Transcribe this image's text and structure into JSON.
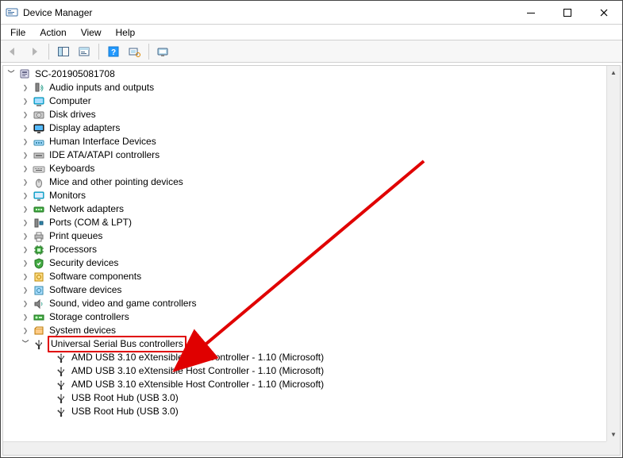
{
  "window": {
    "title": "Device Manager"
  },
  "menu": {
    "file": "File",
    "action": "Action",
    "view": "View",
    "help": "Help"
  },
  "root": {
    "name": "SC-201905081708",
    "expanded": true
  },
  "categories": [
    {
      "name": "Audio inputs and outputs",
      "icon": "audio",
      "expanded": false
    },
    {
      "name": "Computer",
      "icon": "computer",
      "expanded": false
    },
    {
      "name": "Disk drives",
      "icon": "disk",
      "expanded": false
    },
    {
      "name": "Display adapters",
      "icon": "display",
      "expanded": false
    },
    {
      "name": "Human Interface Devices",
      "icon": "hid",
      "expanded": false
    },
    {
      "name": "IDE ATA/ATAPI controllers",
      "icon": "ide",
      "expanded": false
    },
    {
      "name": "Keyboards",
      "icon": "keyboard",
      "expanded": false
    },
    {
      "name": "Mice and other pointing devices",
      "icon": "mouse",
      "expanded": false
    },
    {
      "name": "Monitors",
      "icon": "monitor",
      "expanded": false
    },
    {
      "name": "Network adapters",
      "icon": "network",
      "expanded": false
    },
    {
      "name": "Ports (COM & LPT)",
      "icon": "ports",
      "expanded": false
    },
    {
      "name": "Print queues",
      "icon": "print",
      "expanded": false
    },
    {
      "name": "Processors",
      "icon": "cpu",
      "expanded": false
    },
    {
      "name": "Security devices",
      "icon": "security",
      "expanded": false
    },
    {
      "name": "Software components",
      "icon": "softcomp",
      "expanded": false
    },
    {
      "name": "Software devices",
      "icon": "softdev",
      "expanded": false
    },
    {
      "name": "Sound, video and game controllers",
      "icon": "sound",
      "expanded": false
    },
    {
      "name": "Storage controllers",
      "icon": "storage",
      "expanded": false
    },
    {
      "name": "System devices",
      "icon": "system",
      "expanded": false
    },
    {
      "name": "Universal Serial Bus controllers",
      "icon": "usb",
      "expanded": true,
      "highlighted": true,
      "children": [
        {
          "name": "AMD USB 3.10 eXtensible Host Controller - 1.10 (Microsoft)",
          "icon": "usb"
        },
        {
          "name": "AMD USB 3.10 eXtensible Host Controller - 1.10 (Microsoft)",
          "icon": "usb"
        },
        {
          "name": "AMD USB 3.10 eXtensible Host Controller - 1.10 (Microsoft)",
          "icon": "usb"
        },
        {
          "name": "USB Root Hub (USB 3.0)",
          "icon": "usb"
        },
        {
          "name": "USB Root Hub (USB 3.0)",
          "icon": "usb"
        }
      ]
    }
  ],
  "annotation": {
    "color": "#e00000",
    "target": "Universal Serial Bus controllers"
  }
}
